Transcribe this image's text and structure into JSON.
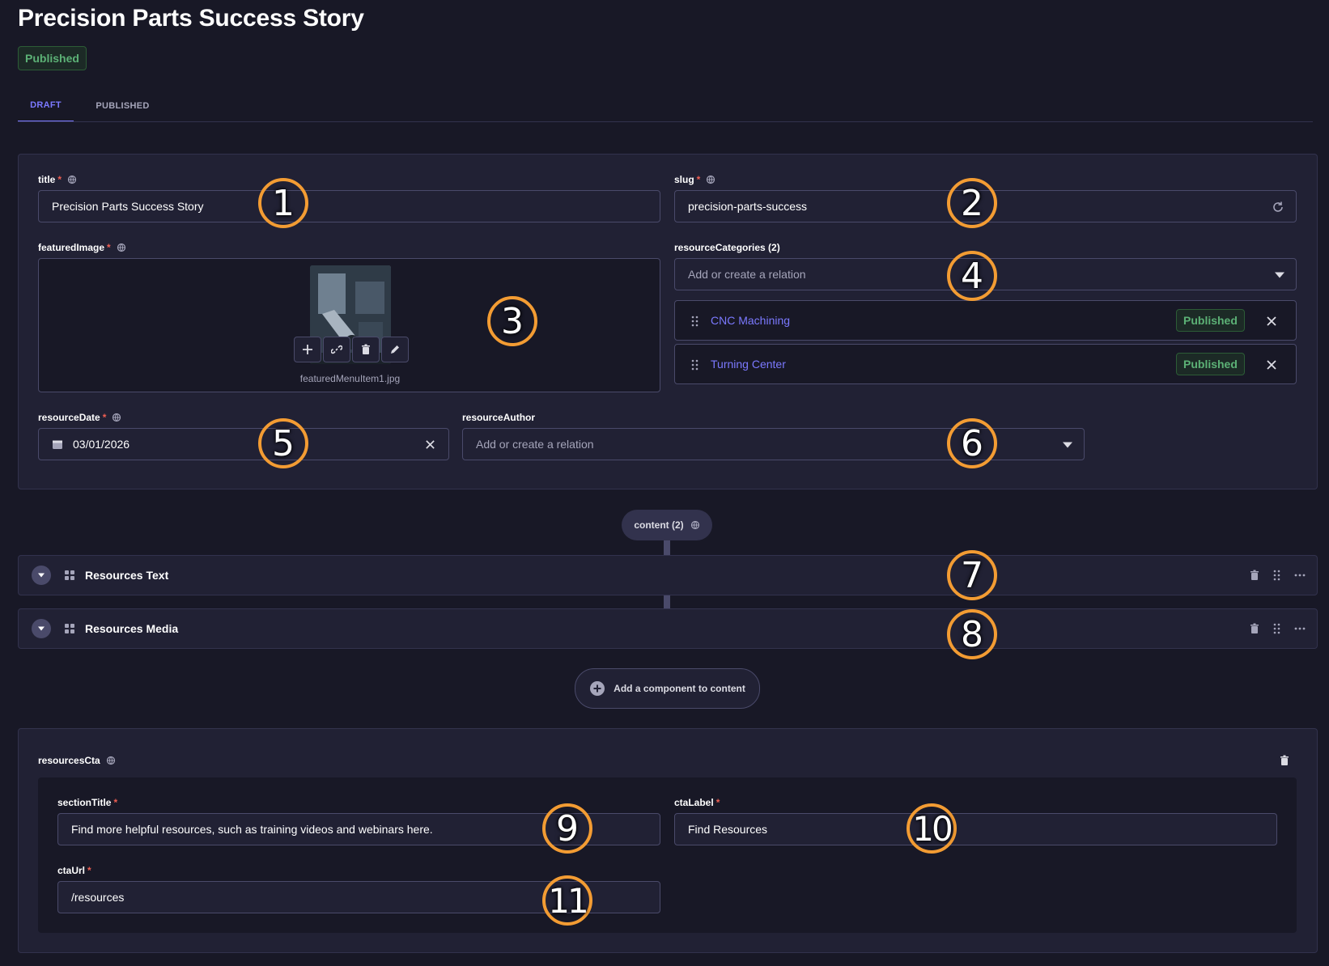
{
  "header": {
    "title": "Precision Parts Success Story",
    "status": "Published",
    "tabs": [
      {
        "label": "DRAFT",
        "active": true
      },
      {
        "label": "PUBLISHED",
        "active": false
      }
    ]
  },
  "fields": {
    "title": {
      "label": "title",
      "value": "Precision Parts Success Story"
    },
    "slug": {
      "label": "slug",
      "value": "precision-parts-success"
    },
    "featuredImage": {
      "label": "featuredImage",
      "filename": "featuredMenuItem1.jpg"
    },
    "resourceCategories": {
      "label": "resourceCategories (2)",
      "placeholder": "Add or create a relation",
      "items": [
        {
          "name": "CNC Machining",
          "status": "Published"
        },
        {
          "name": "Turning Center",
          "status": "Published"
        }
      ]
    },
    "resourceDate": {
      "label": "resourceDate",
      "value": "03/01/2026"
    },
    "resourceAuthor": {
      "label": "resourceAuthor",
      "placeholder": "Add or create a relation"
    }
  },
  "content": {
    "label": "content (2)",
    "components": [
      {
        "title": "Resources Text"
      },
      {
        "title": "Resources Media"
      }
    ],
    "add_label": "Add a component to content"
  },
  "cta": {
    "label": "resourcesCta",
    "sectionTitle": {
      "label": "sectionTitle",
      "value": "Find more helpful resources, such as training videos and webinars here."
    },
    "ctaLabel": {
      "label": "ctaLabel",
      "value": "Find Resources"
    },
    "ctaUrl": {
      "label": "ctaUrl",
      "value": "/resources"
    }
  },
  "markers": [
    "1",
    "2",
    "3",
    "4",
    "5",
    "6",
    "7",
    "8",
    "9",
    "10",
    "11"
  ],
  "colors": {
    "background": "#181826",
    "panel": "#212134",
    "accent": "#7b79ff",
    "success": "#5cb176",
    "danger": "#ee5e52",
    "marker": "#f39c33"
  }
}
